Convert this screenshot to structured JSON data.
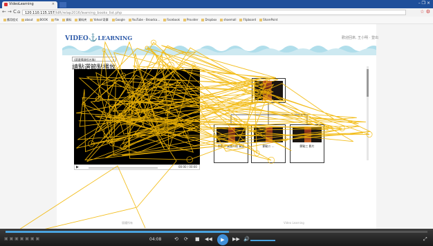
{
  "browser": {
    "tab_title": "VideoLearning",
    "tab_close": "×",
    "window_buttons": "–  ❐  ×",
    "nav": {
      "back": "←",
      "forward": "→",
      "reload": "C",
      "home": "⌂"
    },
    "address_host": "120.110.115.157",
    "address_path": "/IdR/relap2016/learning_books_list.php",
    "bookmarks": [
      "應用程式",
      "about",
      "BOOK",
      "file",
      "資料",
      "資料夾",
      "Yahoo!奇摩",
      "Google",
      "YouTube - Broadca...",
      "Facebook",
      "Provider",
      "Dropbox",
      "shoemall",
      "Flipboard",
      "SharePoint"
    ]
  },
  "page": {
    "logo_video": "VIDEO",
    "logo_learning": "LEARNING",
    "user_info": "歡迎回來, 王小明 · 登出",
    "select_value": "(請選擇課程名稱)",
    "video_title": "請點選節點播放",
    "video_time": "00:00 / 00:00",
    "nodes": [
      {
        "label": "節點一 樂團介紹 資源"
      },
      {
        "label": "節點二 ..."
      },
      {
        "label": "節點三 影片"
      }
    ],
    "footer_left": "版權所有",
    "footer_right": "Video Learning"
  },
  "player": {
    "time": "04:08",
    "progress": 0.53,
    "volume": 0.5
  },
  "colors": {
    "gaze": "#f2b705",
    "accent": "#2d5aa8",
    "progress": "#4aa3df"
  }
}
